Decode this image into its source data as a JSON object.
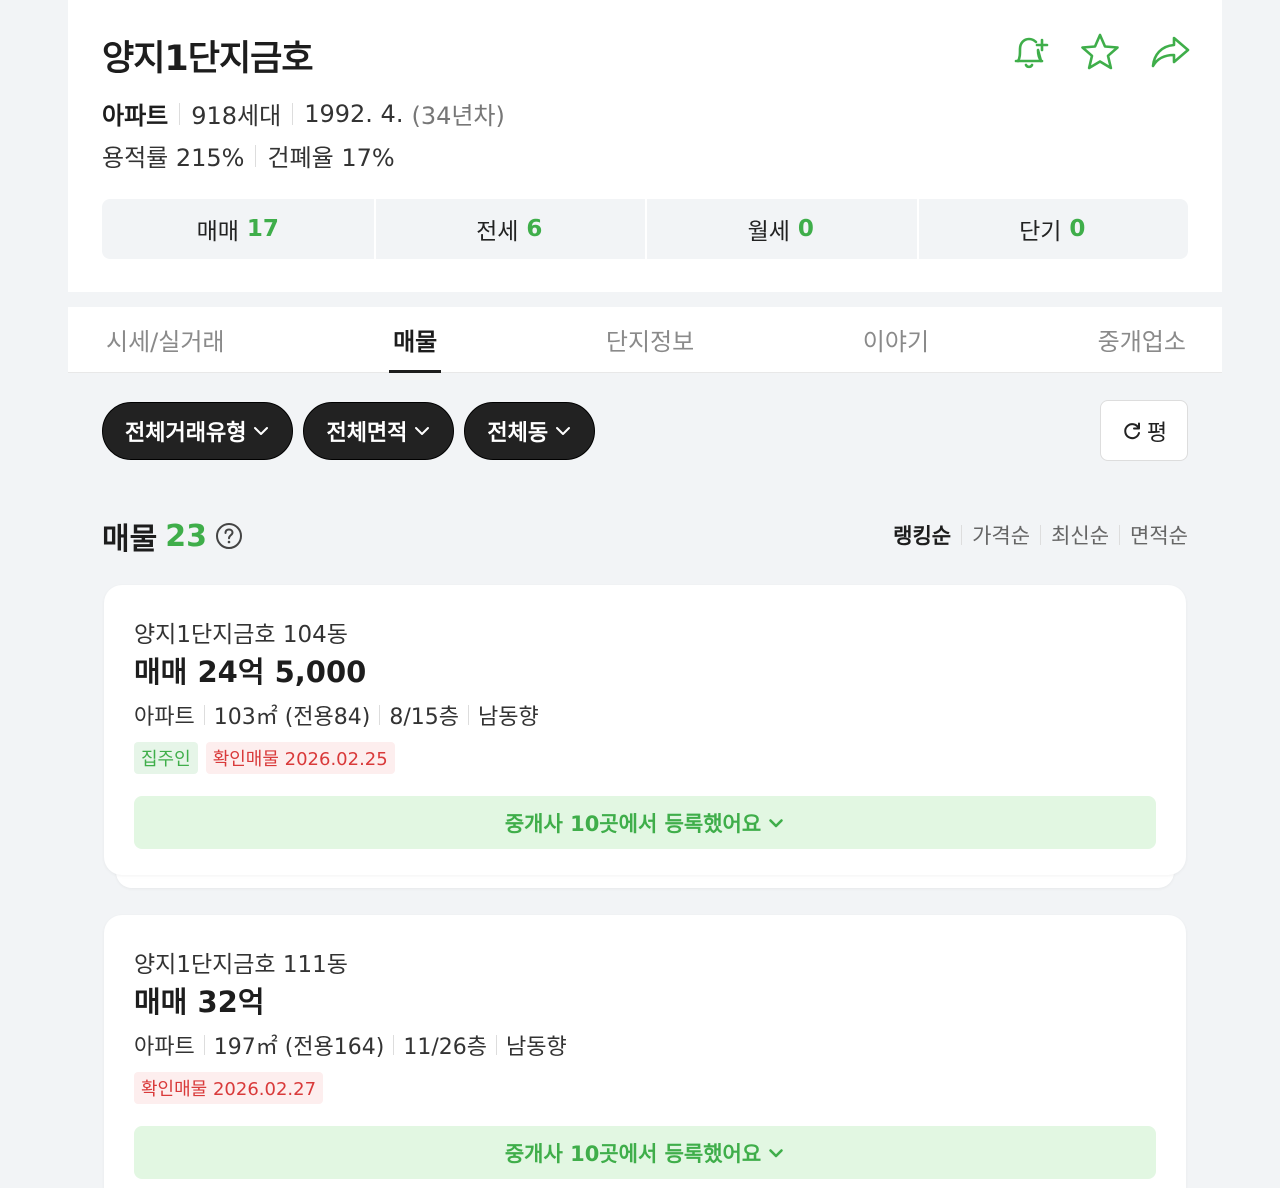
{
  "complex": {
    "title": "양지1단지금호",
    "type": "아파트",
    "households": "918세대",
    "built": "1992. 4.",
    "age": "(34년차)",
    "far": "용적률 215%",
    "bcr": "건폐율 17%"
  },
  "header_actions": {
    "alarm_icon": "bell-plus-icon",
    "favorite_icon": "star-icon",
    "share_icon": "share-arrow-icon"
  },
  "trade_counts": [
    {
      "label": "매매",
      "count": "17"
    },
    {
      "label": "전세",
      "count": "6"
    },
    {
      "label": "월세",
      "count": "0"
    },
    {
      "label": "단기",
      "count": "0"
    }
  ],
  "tabs": [
    "시세/실거래",
    "매물",
    "단지정보",
    "이야기",
    "중개업소"
  ],
  "active_tab": "매물",
  "filters": [
    "전체거래유형",
    "전체면적",
    "전체동"
  ],
  "unit_toggle": "평",
  "listings_header": {
    "label": "매물",
    "count": "23"
  },
  "sort_options": [
    "랭킹순",
    "가격순",
    "최신순",
    "면적순"
  ],
  "active_sort": "랭킹순",
  "listings": [
    {
      "name": "양지1단지금호 104동",
      "price": "매매 24억 5,000",
      "type": "아파트",
      "area": "103㎡ (전용84)",
      "floor": "8/15층",
      "direction": "남동향",
      "tags": [
        {
          "text": "집주인",
          "tone": "green"
        },
        {
          "text": "확인매물 2026.02.25",
          "tone": "red"
        }
      ],
      "brokers": "중개사 10곳에서 등록했어요"
    },
    {
      "name": "양지1단지금호 111동",
      "price": "매매 32억",
      "type": "아파트",
      "area": "197㎡ (전용164)",
      "floor": "11/26층",
      "direction": "남동향",
      "tags": [
        {
          "text": "확인매물 2026.02.27",
          "tone": "red"
        }
      ],
      "brokers": "중개사 10곳에서 등록했어요"
    }
  ],
  "colors": {
    "accent_green": "#3fae4a",
    "confirm_red": "#d93a3a",
    "chip_dark": "#222222"
  }
}
